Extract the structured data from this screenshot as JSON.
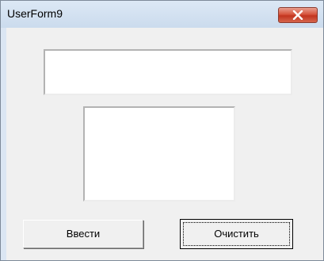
{
  "window": {
    "title": "UserForm9",
    "close_icon": "close-x-icon"
  },
  "form": {
    "textbox_value": "",
    "listbox_items": [],
    "enter_button_label": "Ввести",
    "clear_button_label": "Очистить"
  }
}
